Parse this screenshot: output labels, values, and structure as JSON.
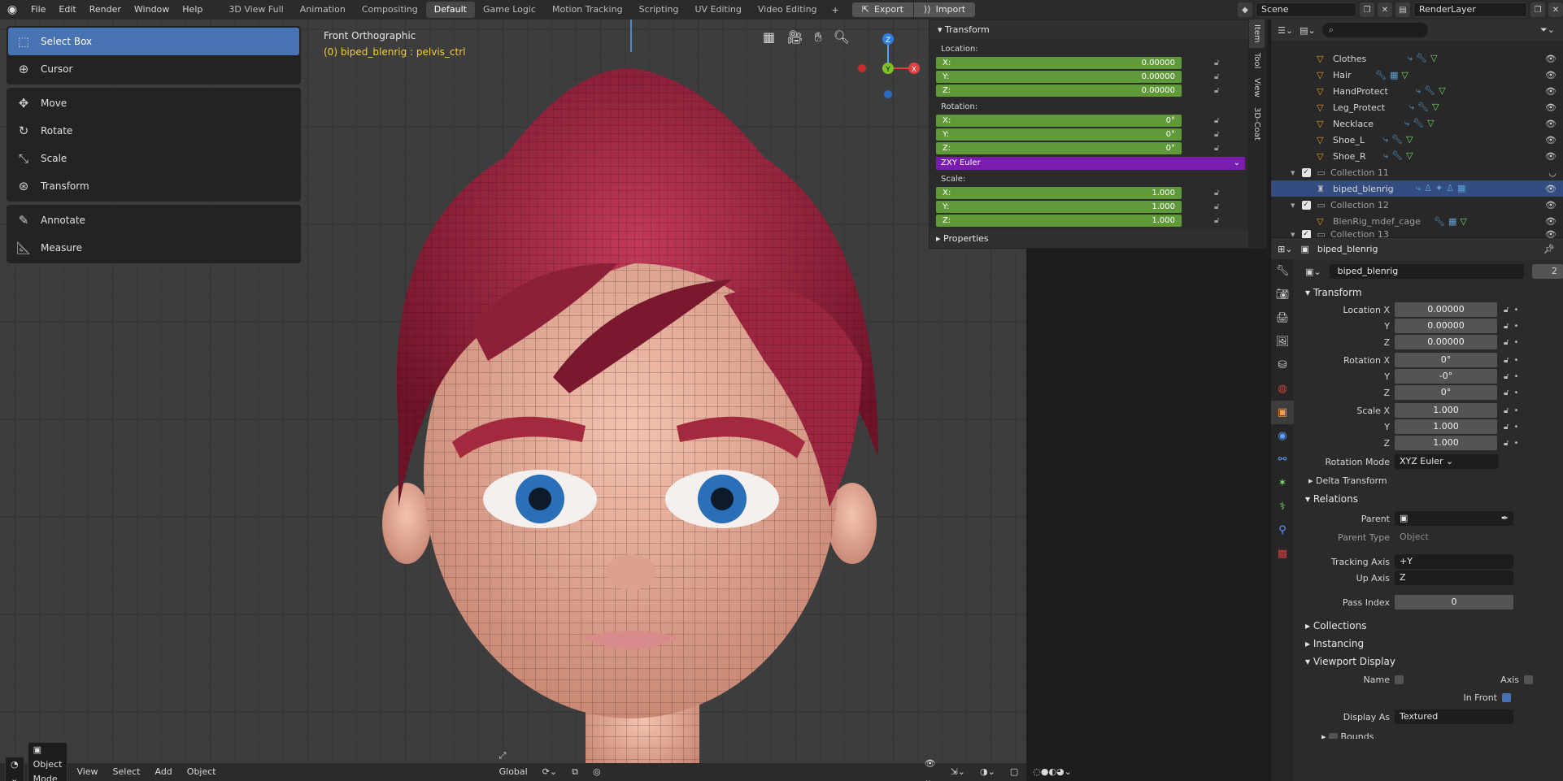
{
  "topbar": {
    "menus": [
      "File",
      "Edit",
      "Render",
      "Window",
      "Help"
    ],
    "workspaces": [
      "3D View Full",
      "Animation",
      "Compositing",
      "Default",
      "Game Logic",
      "Motion Tracking",
      "Scripting",
      "UV Editing",
      "Video Editing"
    ],
    "active_workspace": "Default",
    "export_label": "Export",
    "import_label": "Import",
    "scene": "Scene",
    "view_layer": "RenderLayer"
  },
  "viewport": {
    "view_name": "Front Orthographic",
    "object_info": "(0) biped_blenrig : pelvis_ctrl"
  },
  "toolbar": {
    "tools": [
      "Select Box",
      "Cursor",
      "Move",
      "Rotate",
      "Scale",
      "Transform",
      "Annotate",
      "Measure"
    ],
    "active_tool": "Select Box"
  },
  "gizmo": {
    "z": "Z",
    "y": "Y",
    "x": "X"
  },
  "npanel": {
    "header": "Transform",
    "location_label": "Location:",
    "location": [
      {
        "axis": "X:",
        "value": "0.00000"
      },
      {
        "axis": "Y:",
        "value": "0.00000"
      },
      {
        "axis": "Z:",
        "value": "0.00000"
      }
    ],
    "rotation_label": "Rotation:",
    "rotation": [
      {
        "axis": "X:",
        "value": "0°"
      },
      {
        "axis": "Y:",
        "value": "0°"
      },
      {
        "axis": "Z:",
        "value": "0°"
      }
    ],
    "rotation_mode": "ZXY Euler",
    "scale_label": "Scale:",
    "scale": [
      {
        "axis": "X:",
        "value": "1.000"
      },
      {
        "axis": "Y:",
        "value": "1.000"
      },
      {
        "axis": "Z:",
        "value": "1.000"
      }
    ],
    "properties_label": "Properties",
    "tabs": [
      "Item",
      "Tool",
      "View",
      "3D-Coat"
    ]
  },
  "viewport_header": {
    "mode": "Object Mode",
    "menus": [
      "View",
      "Select",
      "Add",
      "Object"
    ],
    "orientation": "Global"
  },
  "outliner": {
    "items": [
      {
        "name": "Clothes",
        "type": "object"
      },
      {
        "name": "Hair",
        "type": "object"
      },
      {
        "name": "HandProtect",
        "type": "object"
      },
      {
        "name": "Leg_Protect",
        "type": "object"
      },
      {
        "name": "Necklace",
        "type": "object"
      },
      {
        "name": "Shoe_L",
        "type": "object"
      },
      {
        "name": "Shoe_R",
        "type": "object"
      },
      {
        "name": "Collection 11",
        "type": "collection"
      },
      {
        "name": "biped_blenrig",
        "type": "armature",
        "selected": true
      },
      {
        "name": "Collection 12",
        "type": "collection"
      },
      {
        "name": "BlenRig_mdef_cage",
        "type": "object"
      },
      {
        "name": "Collection 13",
        "type": "collection"
      }
    ]
  },
  "properties": {
    "header_object": "biped_blenrig",
    "object_name": "biped_blenrig",
    "users": "2",
    "transform_label": "Transform",
    "location": [
      {
        "label": "Location X",
        "value": "0.00000"
      },
      {
        "label": "Y",
        "value": "0.00000"
      },
      {
        "label": "Z",
        "value": "0.00000"
      }
    ],
    "rotation": [
      {
        "label": "Rotation X",
        "value": "0°"
      },
      {
        "label": "Y",
        "value": "-0°"
      },
      {
        "label": "Z",
        "value": "0°"
      }
    ],
    "scale": [
      {
        "label": "Scale X",
        "value": "1.000"
      },
      {
        "label": "Y",
        "value": "1.000"
      },
      {
        "label": "Z",
        "value": "1.000"
      }
    ],
    "rotation_mode_label": "Rotation Mode",
    "rotation_mode": "XYZ Euler",
    "delta_transform": "Delta Transform",
    "relations_label": "Relations",
    "parent_label": "Parent",
    "parent_type_label": "Parent Type",
    "parent_type": "Object",
    "tracking_axis_label": "Tracking Axis",
    "tracking_axis": "+Y",
    "up_axis_label": "Up Axis",
    "up_axis": "Z",
    "pass_index_label": "Pass Index",
    "pass_index": "0",
    "collections_label": "Collections",
    "instancing_label": "Instancing",
    "viewport_display_label": "Viewport Display",
    "name_label": "Name",
    "axis_label": "Axis",
    "in_front_label": "In Front",
    "display_as_label": "Display As",
    "display_as": "Textured",
    "bounds_label": "Bounds"
  }
}
